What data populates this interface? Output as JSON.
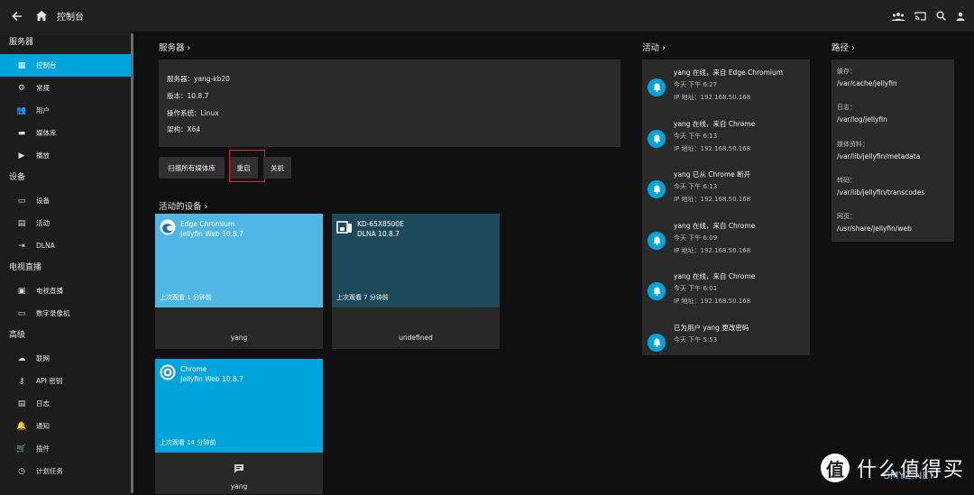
{
  "header": {
    "title": "控制台"
  },
  "sidebar": {
    "sections": [
      {
        "title": "服务器",
        "items": [
          {
            "label": "控制台",
            "icon": "dashboard-icon",
            "glyph": "▦",
            "active": true
          },
          {
            "label": "常规",
            "icon": "gear-icon",
            "glyph": "⚙"
          },
          {
            "label": "用户",
            "icon": "people-icon",
            "glyph": "👥"
          },
          {
            "label": "媒体库",
            "icon": "folder-icon",
            "glyph": "▬"
          },
          {
            "label": "播放",
            "icon": "play-icon",
            "glyph": "▶"
          }
        ]
      },
      {
        "title": "设备",
        "items": [
          {
            "label": "设备",
            "icon": "devices-icon",
            "glyph": "▭"
          },
          {
            "label": "活动",
            "icon": "activity-icon",
            "glyph": "▤"
          },
          {
            "label": "DLNA",
            "icon": "input-icon",
            "glyph": "⇥"
          }
        ]
      },
      {
        "title": "电视直播",
        "items": [
          {
            "label": "电视直播",
            "icon": "live-tv-icon",
            "glyph": "▣"
          },
          {
            "label": "数字录像机",
            "icon": "dvr-icon",
            "glyph": "▭"
          }
        ]
      },
      {
        "title": "高级",
        "items": [
          {
            "label": "联网",
            "icon": "cloud-icon",
            "glyph": "☁"
          },
          {
            "label": "API 密钥",
            "icon": "key-icon",
            "glyph": "⚷"
          },
          {
            "label": "日志",
            "icon": "log-icon",
            "glyph": "▤"
          },
          {
            "label": "通知",
            "icon": "bell-icon",
            "glyph": "🔔"
          },
          {
            "label": "插件",
            "icon": "cart-icon",
            "glyph": "🛒"
          },
          {
            "label": "计划任务",
            "icon": "clock-icon",
            "glyph": "◷"
          }
        ]
      }
    ]
  },
  "server": {
    "heading": "服务器 ›",
    "lines": [
      "服务器：yang-kb20",
      "版本：10.8.7",
      "操作系统：Linux",
      "架构：X64"
    ],
    "buttons": {
      "scan": "扫描所有媒体库",
      "restart": "重启",
      "shutdown": "关机"
    }
  },
  "devices": {
    "heading": "活动的设备 ›",
    "cards": [
      {
        "name": "Edge Chromium",
        "client": "Jellyfin Web 10.8.7",
        "last": "上次观看 1 分钟前",
        "user": "yang",
        "color": "#4fb7e3",
        "logo": "edge-logo-icon"
      },
      {
        "name": "KD-65X8500E",
        "client": "DLNA 10.8.7",
        "last": "上次观看 7 分钟前",
        "user": "undefined",
        "color": "#1c4a5b",
        "logo": "dlna-device-icon"
      },
      {
        "name": "Chrome",
        "client": "Jellyfin Web 10.8.7",
        "last": "上次观看 14 分钟前",
        "user": "yang",
        "color": "#00a4dc",
        "logo": "chrome-logo-icon"
      }
    ]
  },
  "activity": {
    "heading": "活动 ›",
    "items": [
      {
        "title": "yang 在线，来自 Edge Chromium",
        "time": "今天 下午 6:27",
        "ip": "IP 地址：192.168.50.168"
      },
      {
        "title": "yang 在线，来自 Chrome",
        "time": "今天 下午 6:13",
        "ip": "IP 地址：192.168.50.168"
      },
      {
        "title": "yang 已从 Chrome 断开",
        "time": "今天 下午 6:13",
        "ip": "IP 地址：192.168.50.168"
      },
      {
        "title": "yang 在线，来自 Chrome",
        "time": "今天 下午 6:09",
        "ip": "IP 地址：192.168.50.168"
      },
      {
        "title": "yang 在线，来自 Chrome",
        "time": "今天 下午 6:01",
        "ip": "IP 地址：192.168.50.168"
      },
      {
        "title": "已为用户 yang 更改密码",
        "time": "今天 下午 5:53",
        "ip": ""
      }
    ]
  },
  "paths": {
    "heading": "路径 ›",
    "items": [
      {
        "label": "缓存：",
        "value": "/var/cache/jellyfin"
      },
      {
        "label": "日志：",
        "value": "/var/log/jellyfin"
      },
      {
        "label": "媒体资料：",
        "value": "/var/lib/jellyfin/metadata"
      },
      {
        "label": "转码：",
        "value": "/var/lib/jellyfin/transcodes"
      },
      {
        "label": "网页：",
        "value": "/usr/share/jellyfin/web"
      }
    ]
  },
  "watermark": {
    "logo": "值",
    "text": "什么值得买",
    "sub": "SMYZ.NET"
  },
  "colors": {
    "accent": "#00a4dc",
    "highlight": "#e0262c"
  }
}
